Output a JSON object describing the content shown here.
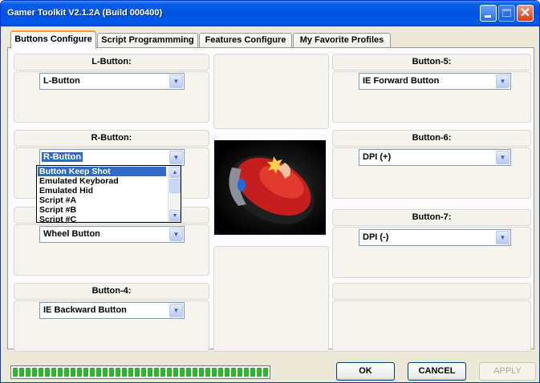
{
  "window": {
    "title": "Gamer Toolkit V2.1.2A (Build 000400)"
  },
  "tabs": [
    {
      "label": "Buttons Configure",
      "active": true
    },
    {
      "label": "Script Programmming",
      "active": false
    },
    {
      "label": "Features Configure",
      "active": false
    },
    {
      "label": "My Favorite Profiles",
      "active": false
    }
  ],
  "left_column": {
    "l_button": {
      "header": "L-Button:",
      "value": "L-Button"
    },
    "r_button": {
      "header": "R-Button:",
      "value": "R-Button"
    },
    "wheel": {
      "value": "Wheel Button"
    },
    "button4": {
      "header": "Button-4:",
      "value": "IE Backward Button"
    }
  },
  "right_column": {
    "button5": {
      "header": "Button-5:",
      "value": "IE Forward Button"
    },
    "button6": {
      "header": "Button-6:",
      "value": "DPI (+)"
    },
    "button7": {
      "header": "Button-7:",
      "value": "DPI (-)"
    }
  },
  "dropdown": {
    "items": [
      "Button Keep Shot",
      "Emulated Keyborad",
      "Emulated Hid",
      "Script #A",
      "Script #B",
      "Script #C"
    ],
    "highlighted": "Button Keep Shot"
  },
  "footer": {
    "progress": 1.0,
    "ok_label": "OK",
    "cancel_label": "CANCEL",
    "apply_label": "APPLY"
  },
  "icons": {
    "minimize": "minimize-icon",
    "maximize": "maximize-icon",
    "close": "close-icon",
    "dropdown_arrow": "chevron-down-icon"
  },
  "colors": {
    "titlebar": "#0053e1",
    "selection": "#316ac5",
    "progress": "#2fb52f",
    "tab_accent": "#ff9a1a"
  }
}
